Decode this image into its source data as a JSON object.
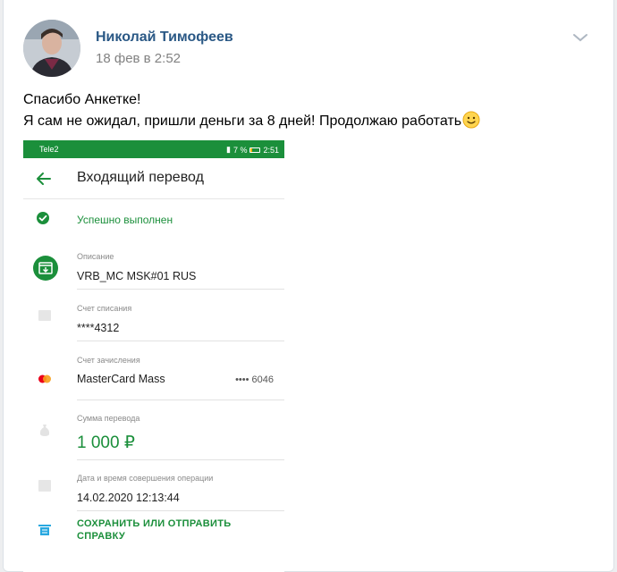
{
  "post": {
    "author": "Николай Тимофеев",
    "date": "18 фев в 2:52",
    "text_line1": "Спасибо Анкетке!",
    "text_line2": "Я сам не ожидал, пришли деньги за 8 дней! Продолжаю работать"
  },
  "phone": {
    "status_bar": {
      "carrier": "Tele2",
      "battery_percent": "7 %",
      "time": "2:51"
    },
    "title": "Входящий перевод",
    "status": "Успешно выполнен",
    "description_label": "Описание",
    "description_value": "VRB_MC MSK#01 RUS",
    "debit_label": "Счет списания",
    "debit_value": "****4312",
    "credit_label": "Счет зачисления",
    "credit_value": "MasterCard Mass",
    "credit_masked": "•••• 6046",
    "amount_label": "Сумма перевода",
    "amount_value": "1 000 ₽",
    "datetime_label": "Дата и время совершения операции",
    "datetime_value": "14.02.2020 12:13:44",
    "action_line1": "СОХРАНИТЬ ИЛИ ОТПРАВИТЬ",
    "action_line2": "СПРАВКУ"
  },
  "colors": {
    "link": "#2a5885",
    "green": "#1b8f3b",
    "muted": "#828282"
  },
  "icons": [
    "chevron-down-icon",
    "emoji-smile-icon",
    "back-arrow-icon",
    "check-circle-icon",
    "card-receive-icon",
    "card-icon",
    "mastercard-icon",
    "money-bag-icon",
    "calendar-icon",
    "receipt-icon"
  ]
}
